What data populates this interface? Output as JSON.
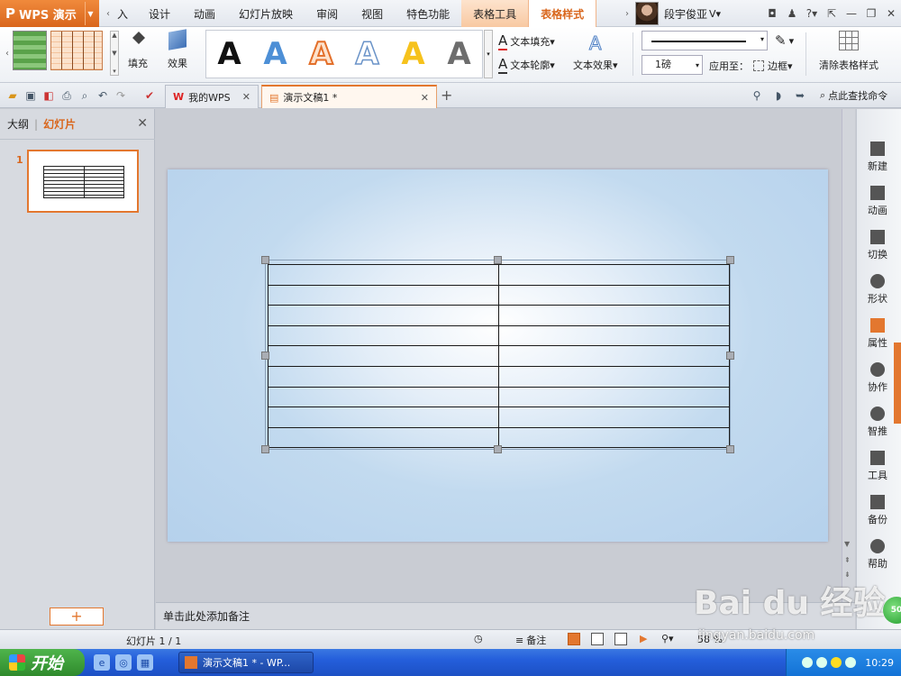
{
  "app": {
    "name": "WPS 演示",
    "logo": "P"
  },
  "menu": {
    "tabs": [
      {
        "label": "入"
      },
      {
        "label": "设计"
      },
      {
        "label": "动画"
      },
      {
        "label": "幻灯片放映"
      },
      {
        "label": "审阅"
      },
      {
        "label": "视图"
      },
      {
        "label": "特色功能"
      },
      {
        "label": "表格工具"
      },
      {
        "label": "表格样式"
      }
    ],
    "active_index": 8
  },
  "user": {
    "name": "段宇俊亚"
  },
  "ribbon": {
    "fill_label": "填充",
    "effect_label": "效果",
    "art_letter": "A",
    "text_fill_label": "文本填充",
    "text_outline_label": "文本轮廓",
    "text_effect_label": "文本效果",
    "line_weight": "1磅",
    "apply_to_label": "应用至：",
    "border_label": "边框",
    "clear_style_label": "清除表格样式"
  },
  "doc_tabs": [
    {
      "label": "我的WPS"
    },
    {
      "label": "演示文稿1 *"
    }
  ],
  "search_command": "点此查找命令",
  "left_pane": {
    "tab_outline": "大纲",
    "tab_slides": "幻灯片",
    "slide_number": "1"
  },
  "notes_placeholder": "单击此处添加备注",
  "right_pane": {
    "items": [
      {
        "label": "新建"
      },
      {
        "label": "动画"
      },
      {
        "label": "切换"
      },
      {
        "label": "形状"
      },
      {
        "label": "属性"
      },
      {
        "label": "协作"
      },
      {
        "label": "智推"
      },
      {
        "label": "工具"
      },
      {
        "label": "备份"
      },
      {
        "label": "帮助"
      }
    ]
  },
  "status": {
    "page": "幻灯片 1 / 1",
    "notes_label": "备注",
    "zoom": "58 %"
  },
  "badge": "50",
  "watermark": {
    "main": "Bai du 经验",
    "sub": "jingyan.baidu.com"
  },
  "taskbar": {
    "start_label": "开始",
    "task_label": "演示文稿1 * - WP...",
    "clock": "10:29"
  },
  "colors": {
    "accent": "#e3772f",
    "slide_bg": "#b5d1ec"
  }
}
